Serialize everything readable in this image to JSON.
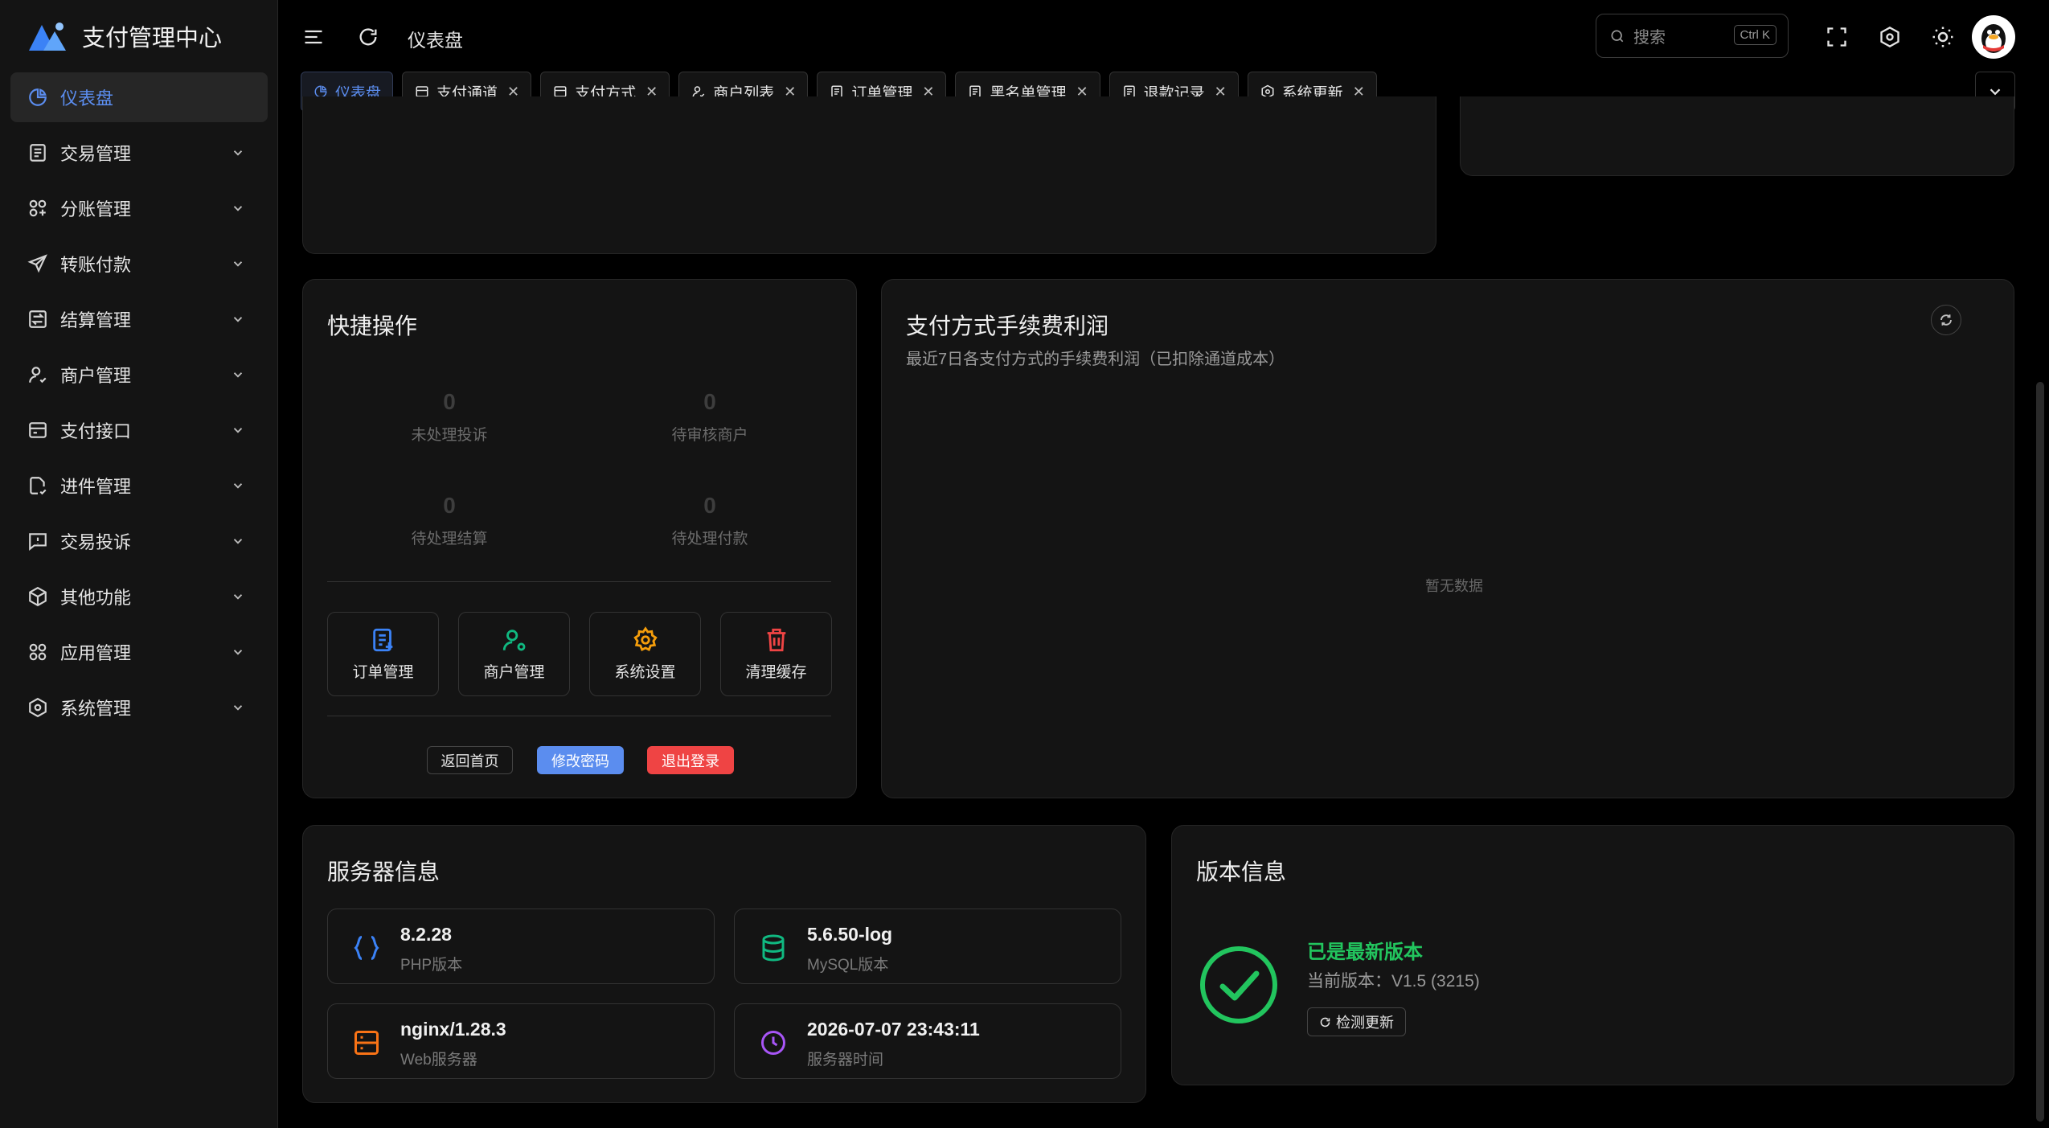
{
  "app": {
    "title": "支付管理中心"
  },
  "sidebar": {
    "items": [
      {
        "label": "仪表盘",
        "icon": "pie-chart-icon",
        "active": true
      },
      {
        "label": "交易管理",
        "icon": "document-list-icon"
      },
      {
        "label": "分账管理",
        "icon": "split-icon"
      },
      {
        "label": "转账付款",
        "icon": "send-icon"
      },
      {
        "label": "结算管理",
        "icon": "settlement-icon"
      },
      {
        "label": "商户管理",
        "icon": "user-icon"
      },
      {
        "label": "支付接口",
        "icon": "card-icon"
      },
      {
        "label": "进件管理",
        "icon": "file-check-icon"
      },
      {
        "label": "交易投诉",
        "icon": "alert-message-icon"
      },
      {
        "label": "其他功能",
        "icon": "cube-icon"
      },
      {
        "label": "应用管理",
        "icon": "grid-icon"
      },
      {
        "label": "系统管理",
        "icon": "hexagon-gear-icon"
      }
    ]
  },
  "header": {
    "title": "仪表盘",
    "search": {
      "placeholder": "搜索",
      "shortcut": "Ctrl K"
    }
  },
  "tabs": [
    {
      "label": "仪表盘",
      "active": true,
      "closable": false
    },
    {
      "label": "支付通道",
      "closable": true
    },
    {
      "label": "支付方式",
      "closable": true
    },
    {
      "label": "商户列表",
      "closable": true
    },
    {
      "label": "订单管理",
      "closable": true
    },
    {
      "label": "黑名单管理",
      "closable": true
    },
    {
      "label": "退款记录",
      "closable": true
    },
    {
      "label": "系统更新",
      "closable": true
    }
  ],
  "quick": {
    "title": "快捷操作",
    "stats": [
      {
        "value": "0",
        "label": "未处理投诉"
      },
      {
        "value": "0",
        "label": "待审核商户"
      },
      {
        "value": "0",
        "label": "待处理结算"
      },
      {
        "value": "0",
        "label": "待处理付款"
      }
    ],
    "actions": [
      {
        "label": "订单管理",
        "color": "#3b82f6"
      },
      {
        "label": "商户管理",
        "color": "#10b981"
      },
      {
        "label": "系统设置",
        "color": "#f59e0b"
      },
      {
        "label": "清理缓存",
        "color": "#ef4444"
      }
    ],
    "buttons": {
      "home": "返回首页",
      "password": "修改密码",
      "logout": "退出登录"
    }
  },
  "profit": {
    "title": "支付方式手续费利润",
    "subtitle": "最近7日各支付方式的手续费利润（已扣除通道成本）",
    "empty": "暂无数据"
  },
  "server": {
    "title": "服务器信息",
    "items": [
      {
        "value": "8.2.28",
        "label": "PHP版本",
        "icon": "braces-icon",
        "color": "#3b82f6"
      },
      {
        "value": "5.6.50-log",
        "label": "MySQL版本",
        "icon": "database-icon",
        "color": "#10b981"
      },
      {
        "value": "nginx/1.28.3",
        "label": "Web服务器",
        "icon": "server-icon",
        "color": "#f97316"
      },
      {
        "value": "2026-07-07 23:43:11",
        "label": "服务器时间",
        "icon": "clock-icon",
        "color": "#a855f7"
      }
    ]
  },
  "version": {
    "title": "版本信息",
    "status": "已是最新版本",
    "current": "当前版本：V1.5 (3215)",
    "check_button": "检测更新"
  },
  "colors": {
    "accent": "#5b8def",
    "success": "#22c55e",
    "danger": "#ef4444"
  }
}
